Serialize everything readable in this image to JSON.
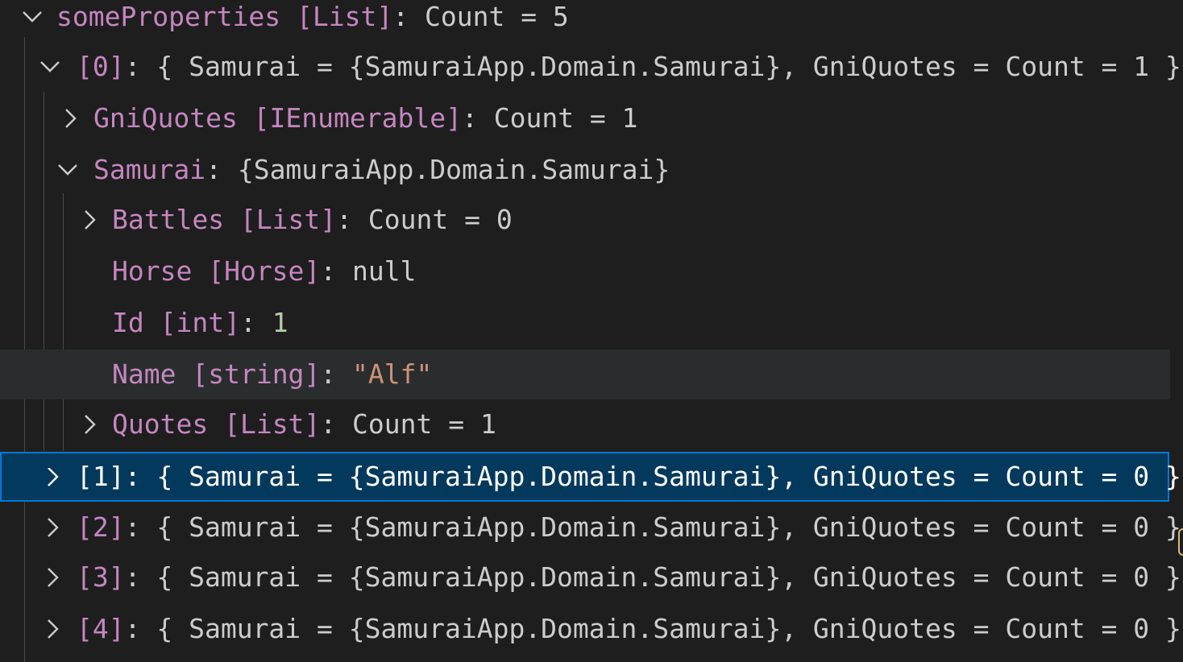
{
  "rows": [
    {
      "id": "r0",
      "expanded": true,
      "hasChildren": true,
      "key": "someProperties",
      "type": " [List]",
      "sep": ": ",
      "value": "Count = 5",
      "valueKind": "plain"
    },
    {
      "id": "r1",
      "expanded": true,
      "hasChildren": true,
      "key": "[0]",
      "type": "",
      "sep": ": ",
      "value": "{ Samurai = {SamuraiApp.Domain.Samurai}, GniQuotes = Count = 1 }",
      "valueKind": "plain"
    },
    {
      "id": "r2",
      "expanded": false,
      "hasChildren": true,
      "key": "GniQuotes",
      "type": " [IEnumerable]",
      "sep": ": ",
      "value": "Count = 1",
      "valueKind": "plain"
    },
    {
      "id": "r3",
      "expanded": true,
      "hasChildren": true,
      "key": "Samurai",
      "type": "",
      "sep": ": ",
      "value": "{SamuraiApp.Domain.Samurai}",
      "valueKind": "plain"
    },
    {
      "id": "r4",
      "expanded": false,
      "hasChildren": true,
      "key": "Battles",
      "type": " [List]",
      "sep": ": ",
      "value": "Count = 0",
      "valueKind": "plain"
    },
    {
      "id": "r5",
      "expanded": false,
      "hasChildren": false,
      "key": "Horse",
      "type": " [Horse]",
      "sep": ": ",
      "value": "null",
      "valueKind": "plain"
    },
    {
      "id": "r6",
      "expanded": false,
      "hasChildren": false,
      "key": "Id",
      "type": " [int]",
      "sep": ": ",
      "value": "1",
      "valueKind": "number"
    },
    {
      "id": "r7",
      "expanded": false,
      "hasChildren": false,
      "key": "Name",
      "type": " [string]",
      "sep": ": ",
      "value": "\"Alf\"",
      "valueKind": "string"
    },
    {
      "id": "r8",
      "expanded": false,
      "hasChildren": true,
      "key": "Quotes",
      "type": " [List]",
      "sep": ": ",
      "value": "Count = 1",
      "valueKind": "plain"
    },
    {
      "id": "r9",
      "expanded": false,
      "hasChildren": true,
      "key": "[1]",
      "type": "",
      "sep": ": ",
      "value": "{ Samurai = {SamuraiApp.Domain.Samurai}, GniQuotes = Count = 0 }",
      "valueKind": "plain"
    },
    {
      "id": "r10",
      "expanded": false,
      "hasChildren": true,
      "key": "[2]",
      "type": "",
      "sep": ": ",
      "value": "{ Samurai = {SamuraiApp.Domain.Samurai}, GniQuotes = Count = 0 }",
      "valueKind": "plain"
    },
    {
      "id": "r11",
      "expanded": false,
      "hasChildren": true,
      "key": "[3]",
      "type": "",
      "sep": ": ",
      "value": "{ Samurai = {SamuraiApp.Domain.Samurai}, GniQuotes = Count = 0 }",
      "valueKind": "plain"
    },
    {
      "id": "r12",
      "expanded": false,
      "hasChildren": true,
      "key": "[4]",
      "type": "",
      "sep": ": ",
      "value": "{ Samurai = {SamuraiApp.Domain.Samurai}, GniQuotes = Count = 0 }",
      "valueKind": "plain"
    }
  ],
  "selected_row": "r9",
  "hover_row": "r7",
  "colors": {
    "background": "#1e1e1e",
    "key": "#c586c0",
    "number": "#b5cea8",
    "string": "#ce9178",
    "selection": "#04395e",
    "selection_border": "#0078d4"
  }
}
